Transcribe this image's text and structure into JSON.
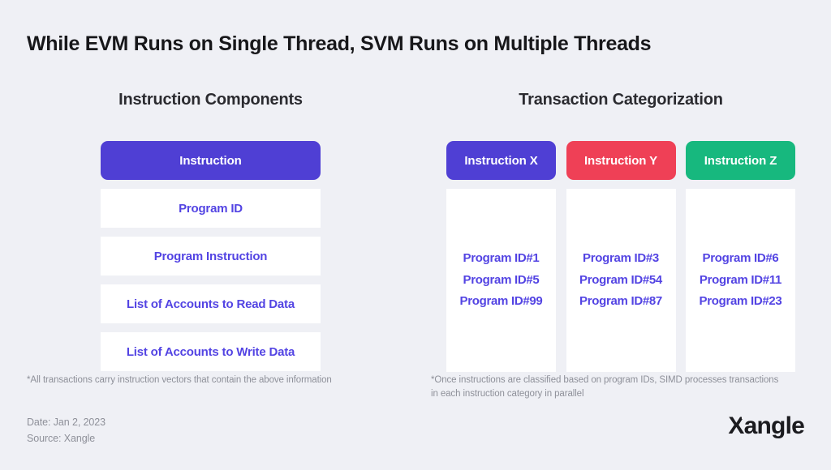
{
  "title": "While EVM Runs on Single Thread, SVM Runs on Multiple Threads",
  "left_panel": {
    "heading": "Instruction Components",
    "header_box": {
      "label": "Instruction",
      "color": "#4f3fd4"
    },
    "items": [
      {
        "label": "Program ID"
      },
      {
        "label": "Program Instruction"
      },
      {
        "label": "List of Accounts to Read Data"
      },
      {
        "label": "List of Accounts to Write Data"
      }
    ],
    "footnote": "*All transactions carry instruction vectors that contain the above information"
  },
  "right_panel": {
    "heading": "Transaction Categorization",
    "columns": [
      {
        "header": "Instruction X",
        "color": "#4f3fd4",
        "program_ids": [
          "Program ID#1",
          "Program ID#5",
          "Program ID#99"
        ]
      },
      {
        "header": "Instruction Y",
        "color": "#ef4056",
        "program_ids": [
          "Program ID#3",
          "Program ID#54",
          "Program ID#87"
        ]
      },
      {
        "header": "Instruction Z",
        "color": "#17b87e",
        "program_ids": [
          "Program ID#6",
          "Program ID#11",
          "Program ID#23"
        ]
      }
    ],
    "footnote": "*Once instructions are classified based on program IDs, SIMD processes transactions in each instruction category in parallel"
  },
  "meta": {
    "date": "Date: Jan 2, 2023",
    "source": "Source: Xangle"
  },
  "logo": {
    "text_x": "X",
    "text_rest": "angle"
  },
  "colors": {
    "background": "#eff0f5",
    "card": "#ffffff",
    "accent_purple": "#4f3fd4",
    "body_purple": "#5344e3",
    "accent_red": "#ef4056",
    "accent_green": "#17b87e",
    "muted_text": "#8e9099",
    "title_text": "#17171a"
  }
}
